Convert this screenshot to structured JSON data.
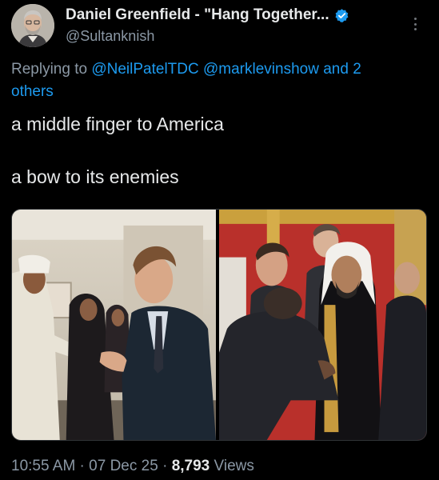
{
  "author": {
    "display_name": "Daniel Greenfield - \"Hang Together...",
    "handle": "@Sultanknish",
    "avatar_icon": "avatar-photo",
    "verified_icon": "verified-badge-icon"
  },
  "reply": {
    "prefix": "Replying to ",
    "mention_1": "@NeilPatelTDC",
    "mention_2": "@marklevinshow",
    "suffix_link": "and 2",
    "suffix_link_2": "others"
  },
  "tweet": {
    "line_1": "a middle finger to America",
    "line_2": "a bow to its enemies"
  },
  "meta": {
    "time": "10:55 AM",
    "separator": " · ",
    "date": "07 Dec 25",
    "views_count": "8,793",
    "views_label": " Views"
  },
  "colors": {
    "background": "#000000",
    "text": "#e7e9ea",
    "muted": "#8b98a5",
    "accent": "#1d9bf0"
  }
}
